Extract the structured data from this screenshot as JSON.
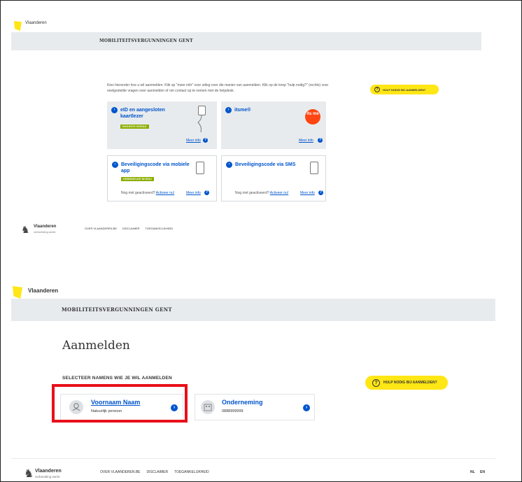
{
  "panel1": {
    "brand": "Vlaanderen",
    "header_title": "MOBILITEITSVERGUNNINGEN GENT",
    "intro_text": "Kies hieronder hoe u wil aanmelden. Klik op \"meer info\" voor uitleg over die manier van aanmelden. Klik op de knop \"hulp nodig?\" (rechts) voor veelgestelde vragen over aanmelden of om contact op te nemen met de helpdesk.",
    "help_button": "HULP NODIG BIJ AANMELDEN?",
    "methods": [
      {
        "title": "eID en aangesloten kaartlezer",
        "tag": "HOOGSTE NIVEAU",
        "meer_info": "Meer info"
      },
      {
        "title": "itsme®",
        "meer_info": "Meer info"
      },
      {
        "title": "Beveiligingscode via mobiele app",
        "tag": "GEMIDDELDE NIVEAU",
        "meer_info": "Meer info",
        "not_activated": "Nog niet geactiveerd?",
        "activate": "Activeer nu!"
      },
      {
        "title": "Beveiligingscode via SMS",
        "meer_info": "Meer info",
        "not_activated": "Nog niet geactiveerd?",
        "activate": "Activeer nu!"
      }
    ],
    "itsme_logo": "its me",
    "footer": {
      "brand": "Vlaanderen",
      "sub": "verbeelding werkt",
      "links": [
        "OVER VLAANDEREN.BE",
        "DISCLAIMER",
        "TOEGANKELIJKHEID"
      ]
    }
  },
  "panel2": {
    "brand": "Vlaanderen",
    "header_title": "MOBILITEITSVERGUNNINGEN GENT",
    "page_title": "Aanmelden",
    "select_label": "SELECTEER NAMENS WIE JE WIL AANMELDEN",
    "help_button": "HULP NODIG BIJ AANMELDEN?",
    "options": [
      {
        "name": "Voornaam Naam",
        "sub": "Natuurlijk persoon"
      },
      {
        "name": "Onderneming",
        "sub": "0888999999"
      }
    ],
    "footer": {
      "brand": "Vlaanderen",
      "sub": "verbeelding werkt",
      "links": [
        "OVER VLAANDEREN.BE",
        "DISCLAIMER",
        "TOEGANKELIJKHEID"
      ],
      "languages": [
        "NL",
        "EN"
      ]
    }
  },
  "colors": {
    "accent_yellow": "#ffe615",
    "link_blue": "#0055cc",
    "header_grey": "#e8ebee",
    "tag_green": "#8bae00",
    "highlight_red": "#e8101a",
    "itsme_orange": "#ff4612"
  },
  "icons": [
    "vlaanderen-flag-icon",
    "question-icon",
    "chevron-right-icon",
    "card-reader-icon",
    "phone-app-icon",
    "phone-sms-icon",
    "person-icon",
    "building-icon",
    "lion-logo-icon"
  ]
}
